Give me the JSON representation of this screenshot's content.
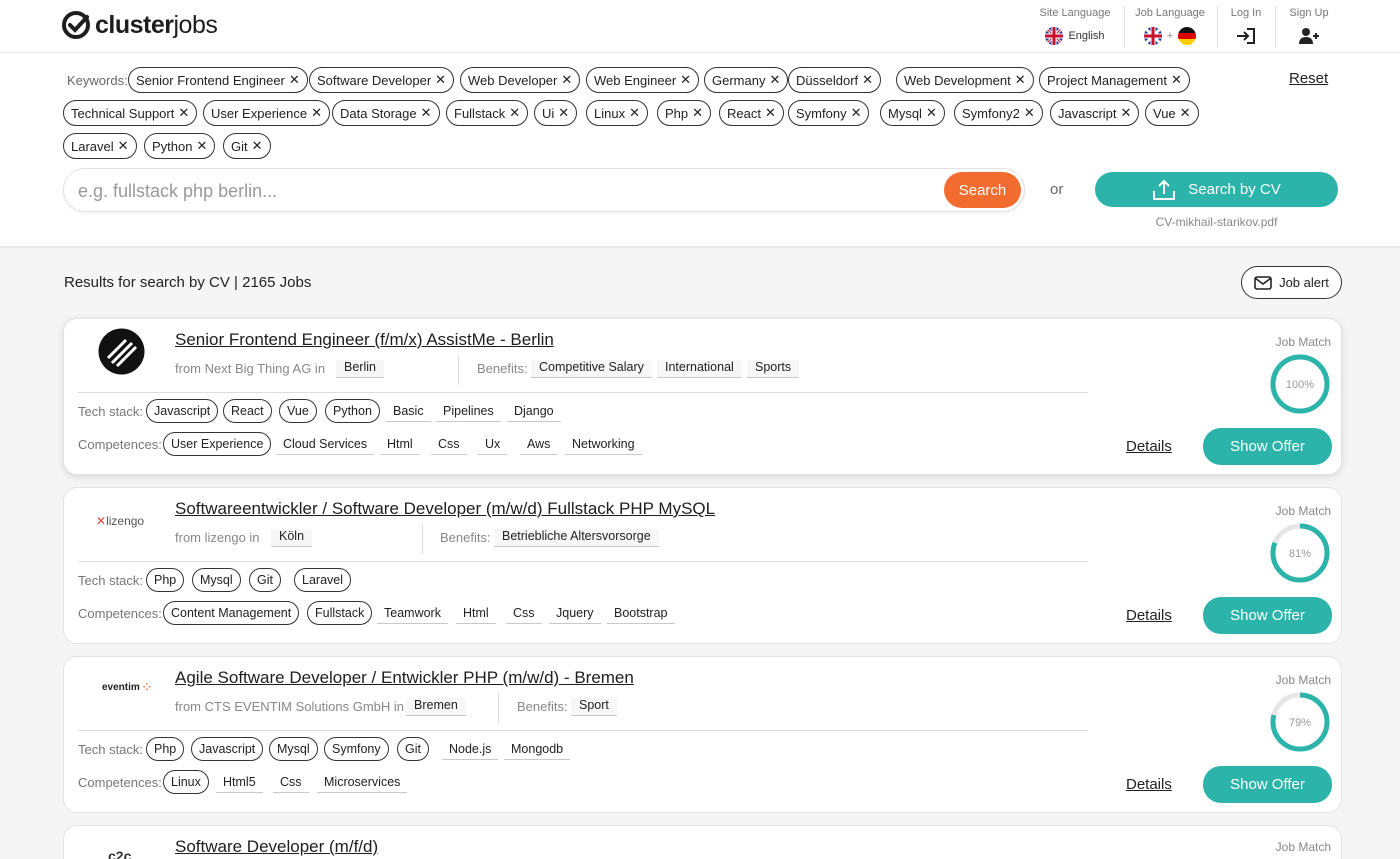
{
  "brand": {
    "name_bold": "cluster",
    "name_light": "jobs"
  },
  "header": {
    "site_language_label": "Site Language",
    "site_language_value": "English",
    "job_language_label": "Job Language",
    "job_language_plus": "+",
    "login_label": "Log In",
    "signup_label": "Sign Up"
  },
  "keywords": {
    "label": "Keywords:",
    "reset_label": "Reset",
    "chips": [
      "Senior Frontend Engineer",
      "Software Developer",
      "Web Developer",
      "Web Engineer",
      "Germany",
      "Düsseldorf",
      "Web Development",
      "Project Management",
      "Technical Support",
      "User Experience",
      "Data Storage",
      "Fullstack",
      "Ui",
      "Linux",
      "Php",
      "React",
      "Symfony",
      "Mysql",
      "Symfony2",
      "Javascript",
      "Vue",
      "Laravel",
      "Python",
      "Git"
    ]
  },
  "search": {
    "placeholder": "e.g. fullstack php berlin...",
    "button_label": "Search",
    "or_label": "or",
    "cv_button_label": "Search by CV",
    "cv_filename": "CV-mikhail-starikov.pdf"
  },
  "results": {
    "title": "Results for search by CV | 2165 Jobs",
    "job_alert_label": "Job alert"
  },
  "labels": {
    "job_match": "Job Match",
    "tech_stack": "Tech stack:",
    "competences": "Competences:",
    "benefits": "Benefits:",
    "details": "Details",
    "show_offer": "Show Offer"
  },
  "jobs": [
    {
      "title": "Senior Frontend Engineer (f/m/x) AssistMe - Berlin",
      "from": "from Next Big Thing AG   in",
      "location": "Berlin",
      "benefits": [
        "Competitive Salary",
        "International",
        "Sports"
      ],
      "tech_matched": [
        "Javascript",
        "React",
        "Vue",
        "Python"
      ],
      "tech_other": [
        "Basic",
        "Pipelines",
        "Django"
      ],
      "comp_matched": [
        "User Experience"
      ],
      "comp_other": [
        "Cloud Services",
        "Html",
        "Css",
        "Ux",
        "Aws",
        "Networking"
      ],
      "match": 100,
      "match_label": "100%"
    },
    {
      "title": "Softwareentwickler / Software Developer (m/w/d) Fullstack PHP MySQL",
      "from": "from lizengo   in",
      "location": "Köln",
      "logo_text": "lizengo",
      "benefits": [
        "Betriebliche Altersvorsorge"
      ],
      "tech_matched": [
        "Php",
        "Mysql",
        "Git",
        "Laravel"
      ],
      "tech_other": [],
      "comp_matched": [
        "Content Management",
        "Fullstack"
      ],
      "comp_other": [
        "Teamwork",
        "Html",
        "Css",
        "Jquery",
        "Bootstrap"
      ],
      "match": 81,
      "match_label": "81%"
    },
    {
      "title": "Agile Software Developer / Entwickler PHP (m/w/d) - Bremen",
      "from": "from CTS EVENTIM Solutions GmbH   in",
      "location": "Bremen",
      "logo_text": "eventim",
      "benefits": [
        "Sport"
      ],
      "tech_matched": [
        "Php",
        "Javascript",
        "Mysql",
        "Symfony",
        "Git"
      ],
      "tech_other": [
        "Node.js",
        "Mongodb"
      ],
      "comp_matched": [
        "Linux"
      ],
      "comp_other": [
        "Html5",
        "Css",
        "Microservices"
      ],
      "match": 79,
      "match_label": "79%"
    },
    {
      "title": "Software Developer (m/f/d)"
    }
  ],
  "colors": {
    "accent": "#2cb4ab",
    "search": "#f26b2f"
  }
}
